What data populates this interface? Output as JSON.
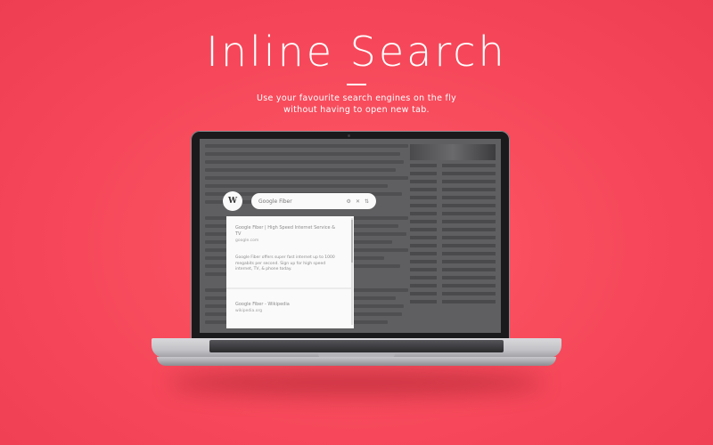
{
  "hero": {
    "title": "Inline Search",
    "subtitle_line1": "Use your favourite search engines on the fly",
    "subtitle_line2": "without having to open new tab."
  },
  "search": {
    "logo": "W",
    "query": "Google Fiber",
    "icons": [
      "gear-icon",
      "close-icon",
      "settings-icon"
    ]
  },
  "results": [
    {
      "title": "Google Fiber | High Speed Internet Service & TV",
      "url": "google.com",
      "snippet": "Google Fiber offers super fast internet up to 1000 megabits per second. Sign up for high speed internet, TV, & phone today."
    },
    {
      "title": "Google Fiber - Wikipedia",
      "url": "wikipedia.org"
    }
  ],
  "colors": {
    "background": "#f6485a",
    "accent": "#ffffff"
  }
}
